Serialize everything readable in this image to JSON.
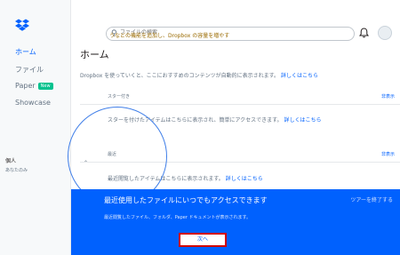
{
  "sidebar": {
    "items": [
      {
        "label": "ホーム"
      },
      {
        "label": "ファイル"
      },
      {
        "label": "Paper",
        "badge": "New"
      },
      {
        "label": "Showcase"
      }
    ],
    "account": {
      "title": "個人",
      "subtitle": "あなたのみ"
    }
  },
  "header": {
    "search_placeholder": "ファイルの検索",
    "promo_text": "うなどの機能を追加し、Dropbox の容量を増やす"
  },
  "main": {
    "title": "ホーム",
    "intro_text": "Dropbox を使っていくと、ここにおすすめのコンテンツが自動的に表示されます。",
    "details_link": "詳しくはこちら",
    "sections": [
      {
        "label": "スター付き",
        "hide_label": "非表示",
        "message": "スターを付けたアイテムはこちらに表示され、簡単にアクセスできます。",
        "link": "詳しくはこちら"
      },
      {
        "label": "最近",
        "hide_label": "非表示",
        "message": "最近閲覧したアイテムはこちらに表示されます。",
        "link": "詳しくはこちら"
      }
    ]
  },
  "tour": {
    "title": "最近使用したファイルにいつでもアクセスできます",
    "body": "最近閲覧したファイル、フォルダ、Paper ドキュメントが表示されます。",
    "end_label": "ツアーを終了する",
    "next_label": "次へ"
  },
  "colors": {
    "accent": "#0061fe",
    "highlight_border": "#d00000",
    "badge": "#00c28e"
  }
}
